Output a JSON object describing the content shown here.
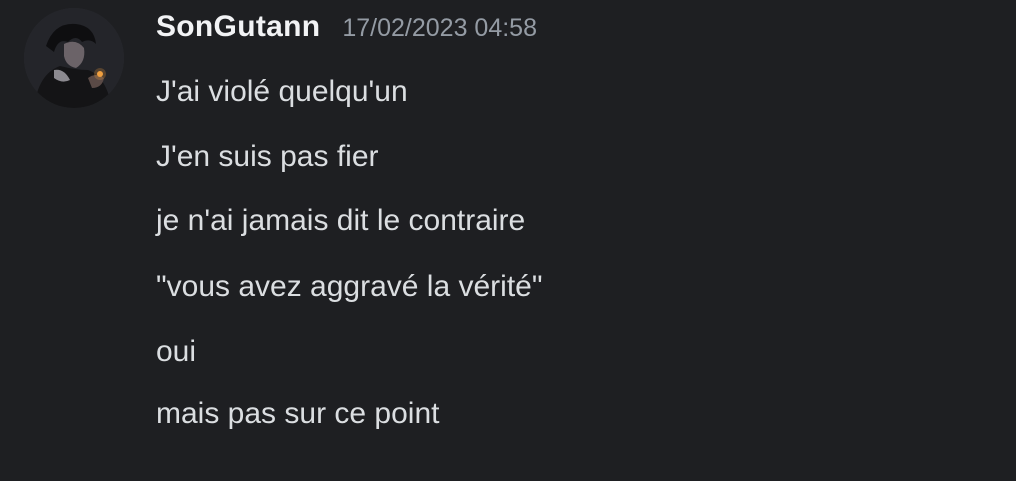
{
  "message": {
    "author": "SonGutann",
    "timestamp": "17/02/2023 04:58",
    "avatar_icon": "user-avatar-icon",
    "lines": [
      "J'ai violé quelqu'un",
      "J'en suis pas fier",
      "je n'ai jamais dit le contraire",
      "\"vous avez aggravé la vérité\"",
      "oui",
      "mais pas sur ce point"
    ]
  },
  "colors": {
    "background": "#1e1f22",
    "username": "#f2f3f5",
    "timestamp": "#949ba4",
    "message_text": "#dbdee1"
  }
}
